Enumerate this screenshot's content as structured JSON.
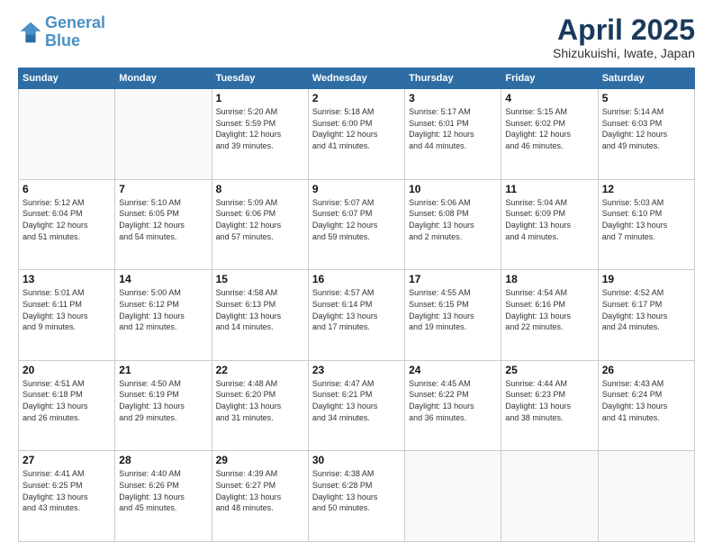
{
  "header": {
    "logo_line1": "General",
    "logo_line2": "Blue",
    "month_title": "April 2025",
    "subtitle": "Shizukuishi, Iwate, Japan"
  },
  "weekdays": [
    "Sunday",
    "Monday",
    "Tuesday",
    "Wednesday",
    "Thursday",
    "Friday",
    "Saturday"
  ],
  "weeks": [
    [
      {
        "day": "",
        "info": ""
      },
      {
        "day": "",
        "info": ""
      },
      {
        "day": "1",
        "info": "Sunrise: 5:20 AM\nSunset: 5:59 PM\nDaylight: 12 hours\nand 39 minutes."
      },
      {
        "day": "2",
        "info": "Sunrise: 5:18 AM\nSunset: 6:00 PM\nDaylight: 12 hours\nand 41 minutes."
      },
      {
        "day": "3",
        "info": "Sunrise: 5:17 AM\nSunset: 6:01 PM\nDaylight: 12 hours\nand 44 minutes."
      },
      {
        "day": "4",
        "info": "Sunrise: 5:15 AM\nSunset: 6:02 PM\nDaylight: 12 hours\nand 46 minutes."
      },
      {
        "day": "5",
        "info": "Sunrise: 5:14 AM\nSunset: 6:03 PM\nDaylight: 12 hours\nand 49 minutes."
      }
    ],
    [
      {
        "day": "6",
        "info": "Sunrise: 5:12 AM\nSunset: 6:04 PM\nDaylight: 12 hours\nand 51 minutes."
      },
      {
        "day": "7",
        "info": "Sunrise: 5:10 AM\nSunset: 6:05 PM\nDaylight: 12 hours\nand 54 minutes."
      },
      {
        "day": "8",
        "info": "Sunrise: 5:09 AM\nSunset: 6:06 PM\nDaylight: 12 hours\nand 57 minutes."
      },
      {
        "day": "9",
        "info": "Sunrise: 5:07 AM\nSunset: 6:07 PM\nDaylight: 12 hours\nand 59 minutes."
      },
      {
        "day": "10",
        "info": "Sunrise: 5:06 AM\nSunset: 6:08 PM\nDaylight: 13 hours\nand 2 minutes."
      },
      {
        "day": "11",
        "info": "Sunrise: 5:04 AM\nSunset: 6:09 PM\nDaylight: 13 hours\nand 4 minutes."
      },
      {
        "day": "12",
        "info": "Sunrise: 5:03 AM\nSunset: 6:10 PM\nDaylight: 13 hours\nand 7 minutes."
      }
    ],
    [
      {
        "day": "13",
        "info": "Sunrise: 5:01 AM\nSunset: 6:11 PM\nDaylight: 13 hours\nand 9 minutes."
      },
      {
        "day": "14",
        "info": "Sunrise: 5:00 AM\nSunset: 6:12 PM\nDaylight: 13 hours\nand 12 minutes."
      },
      {
        "day": "15",
        "info": "Sunrise: 4:58 AM\nSunset: 6:13 PM\nDaylight: 13 hours\nand 14 minutes."
      },
      {
        "day": "16",
        "info": "Sunrise: 4:57 AM\nSunset: 6:14 PM\nDaylight: 13 hours\nand 17 minutes."
      },
      {
        "day": "17",
        "info": "Sunrise: 4:55 AM\nSunset: 6:15 PM\nDaylight: 13 hours\nand 19 minutes."
      },
      {
        "day": "18",
        "info": "Sunrise: 4:54 AM\nSunset: 6:16 PM\nDaylight: 13 hours\nand 22 minutes."
      },
      {
        "day": "19",
        "info": "Sunrise: 4:52 AM\nSunset: 6:17 PM\nDaylight: 13 hours\nand 24 minutes."
      }
    ],
    [
      {
        "day": "20",
        "info": "Sunrise: 4:51 AM\nSunset: 6:18 PM\nDaylight: 13 hours\nand 26 minutes."
      },
      {
        "day": "21",
        "info": "Sunrise: 4:50 AM\nSunset: 6:19 PM\nDaylight: 13 hours\nand 29 minutes."
      },
      {
        "day": "22",
        "info": "Sunrise: 4:48 AM\nSunset: 6:20 PM\nDaylight: 13 hours\nand 31 minutes."
      },
      {
        "day": "23",
        "info": "Sunrise: 4:47 AM\nSunset: 6:21 PM\nDaylight: 13 hours\nand 34 minutes."
      },
      {
        "day": "24",
        "info": "Sunrise: 4:45 AM\nSunset: 6:22 PM\nDaylight: 13 hours\nand 36 minutes."
      },
      {
        "day": "25",
        "info": "Sunrise: 4:44 AM\nSunset: 6:23 PM\nDaylight: 13 hours\nand 38 minutes."
      },
      {
        "day": "26",
        "info": "Sunrise: 4:43 AM\nSunset: 6:24 PM\nDaylight: 13 hours\nand 41 minutes."
      }
    ],
    [
      {
        "day": "27",
        "info": "Sunrise: 4:41 AM\nSunset: 6:25 PM\nDaylight: 13 hours\nand 43 minutes."
      },
      {
        "day": "28",
        "info": "Sunrise: 4:40 AM\nSunset: 6:26 PM\nDaylight: 13 hours\nand 45 minutes."
      },
      {
        "day": "29",
        "info": "Sunrise: 4:39 AM\nSunset: 6:27 PM\nDaylight: 13 hours\nand 48 minutes."
      },
      {
        "day": "30",
        "info": "Sunrise: 4:38 AM\nSunset: 6:28 PM\nDaylight: 13 hours\nand 50 minutes."
      },
      {
        "day": "",
        "info": ""
      },
      {
        "day": "",
        "info": ""
      },
      {
        "day": "",
        "info": ""
      }
    ]
  ]
}
